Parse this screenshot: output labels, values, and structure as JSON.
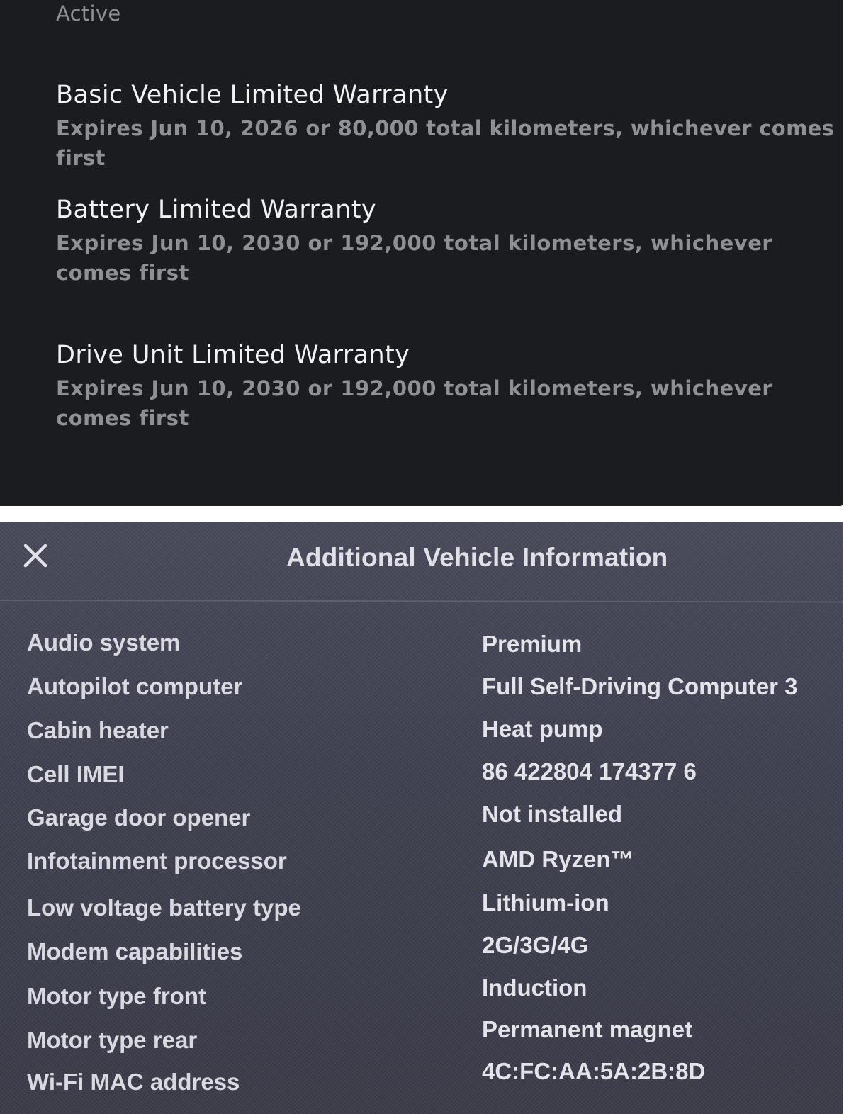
{
  "warranty_section": {
    "status": "Active",
    "items": [
      {
        "title": "Basic Vehicle Limited Warranty",
        "description": "Expires Jun 10, 2026 or 80,000 total kilometers, whichever comes first"
      },
      {
        "title": "Battery Limited Warranty",
        "description": "Expires Jun 10, 2030 or 192,000 total kilometers, whichever comes first"
      },
      {
        "title": "Drive Unit Limited Warranty",
        "description": "Expires Jun 10, 2030 or 192,000 total kilometers, whichever comes first"
      }
    ]
  },
  "vehicle_info": {
    "title": "Additional Vehicle Information",
    "close_icon": "close-icon",
    "rows": [
      {
        "label": "Audio system",
        "value": "Premium"
      },
      {
        "label": "Autopilot computer",
        "value": "Full Self-Driving Computer 3"
      },
      {
        "label": "Cabin heater",
        "value": "Heat pump"
      },
      {
        "label": "Cell IMEI",
        "value": "86 422804 174377 6"
      },
      {
        "label": "Garage door opener",
        "value": "Not installed"
      },
      {
        "label": "Infotainment processor",
        "value": "AMD Ryzen™"
      },
      {
        "label": "Low voltage battery type",
        "value": "Lithium-ion"
      },
      {
        "label": "Modem capabilities",
        "value": "2G/3G/4G"
      },
      {
        "label": "Motor type front",
        "value": "Induction"
      },
      {
        "label": "Motor type rear",
        "value": "Permanent magnet"
      },
      {
        "label": "Wi-Fi MAC address",
        "value": "4C:FC:AA:5A:2B:8D"
      }
    ]
  },
  "colors": {
    "warranty_bg": "#1b1c20",
    "info_bg": "#41434f",
    "title_text": "#f2f2f3",
    "muted_text": "#8f9095"
  }
}
